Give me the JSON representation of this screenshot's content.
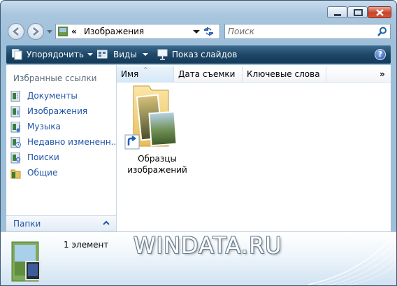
{
  "window": {
    "controls": {
      "minimize": "minimize",
      "maximize": "maximize",
      "close": "close"
    }
  },
  "address": {
    "separator": "«",
    "crumb": "Изображения",
    "icon": "pictures-folder-icon"
  },
  "search": {
    "placeholder": "Поиск",
    "icon": "search-icon"
  },
  "toolbar": {
    "organize_label": "Упорядочить",
    "views_label": "Виды",
    "slideshow_label": "Показ слайдов",
    "help_label": "?"
  },
  "sidebar": {
    "heading": "Избранные ссылки",
    "items": [
      {
        "label": "Документы",
        "icon": "documents-icon"
      },
      {
        "label": "Изображения",
        "icon": "pictures-icon"
      },
      {
        "label": "Музыка",
        "icon": "music-icon"
      },
      {
        "label": "Недавно измененн...",
        "icon": "recent-icon"
      },
      {
        "label": "Поиски",
        "icon": "searches-icon"
      },
      {
        "label": "Общие",
        "icon": "public-folder-icon"
      }
    ],
    "folders_label": "Папки"
  },
  "columns": [
    "Имя",
    "Дата съемки",
    "Ключевые слова"
  ],
  "columns_more": "»",
  "sort_indicator": "^",
  "items": [
    {
      "label_line1": "Образцы",
      "label_line2": "изображений",
      "icon": "sample-pictures-shortcut-icon"
    }
  ],
  "details": {
    "count": "1 элемент",
    "watermark": "WINDATA.RU"
  },
  "colors": {
    "toolbar": "#1e4767",
    "link": "#1f54a8",
    "frame": "#a9c6de"
  }
}
